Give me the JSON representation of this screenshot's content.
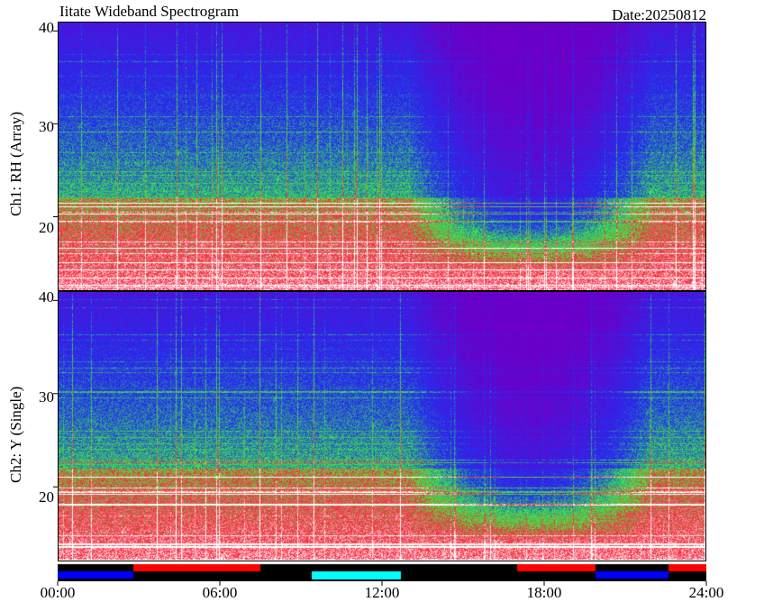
{
  "header": {
    "title": "Iitate Wideband Spectrogram",
    "date": "Date:20250812"
  },
  "chart_data": [
    {
      "type": "heatmap",
      "title": "",
      "ylabel": "Ch1: RH (Array)",
      "xlabel": "",
      "x_ticks": [
        "00:00",
        "06:00",
        "12:00",
        "18:00",
        "24:00"
      ],
      "xlim_hours": [
        0,
        24
      ],
      "y_ticks": [
        20,
        30,
        40
      ],
      "ylim": [
        12,
        41
      ]
    },
    {
      "type": "heatmap",
      "title": "",
      "ylabel": "Ch2: Y (Single)",
      "xlabel": "",
      "x_ticks": [
        "00:00",
        "06:00",
        "12:00",
        "18:00",
        "24:00"
      ],
      "xlim_hours": [
        0,
        24
      ],
      "y_ticks": [
        20,
        30,
        40
      ],
      "ylim": [
        12,
        41
      ]
    }
  ],
  "status_bar": {
    "segments": [
      {
        "start": 0.0,
        "end": 2.8,
        "color": "#0000ff"
      },
      {
        "start": 2.8,
        "end": 7.5,
        "color": "#ff0000"
      },
      {
        "start": 7.5,
        "end": 9.4,
        "color": "#000000"
      },
      {
        "start": 9.4,
        "end": 12.7,
        "color": "#00ffff"
      },
      {
        "start": 12.7,
        "end": 17.0,
        "color": "#000000"
      },
      {
        "start": 17.0,
        "end": 19.9,
        "color": "#ff0000"
      },
      {
        "start": 19.9,
        "end": 22.6,
        "color": "#0000ff"
      },
      {
        "start": 22.6,
        "end": 24.0,
        "color": "#ff0000"
      }
    ]
  },
  "colors": {
    "low": "#6a00c8",
    "mid_low": "#2030f0",
    "mid": "#40f040",
    "high": "#ff2040",
    "max": "#ffffff"
  }
}
